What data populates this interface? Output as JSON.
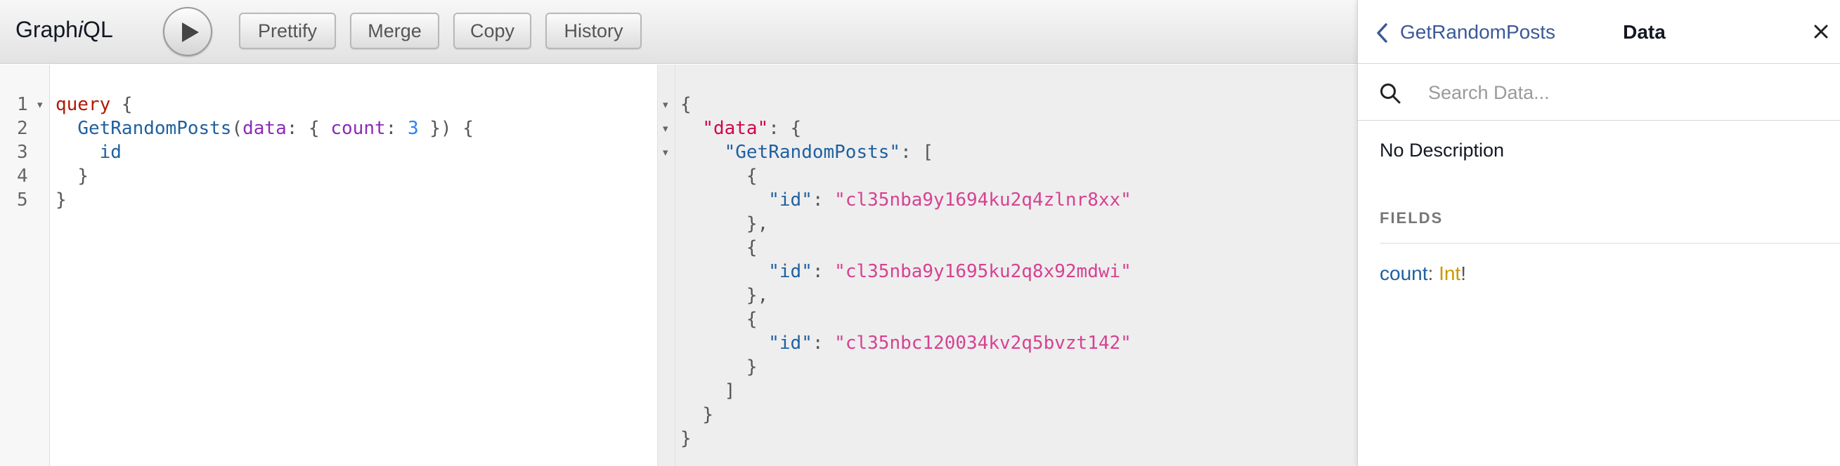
{
  "toolbar": {
    "logo_pre": "Graph",
    "logo_i": "i",
    "logo_post": "QL",
    "run_icon": "play-icon",
    "buttons": {
      "prettify": "Prettify",
      "merge": "Merge",
      "copy": "Copy",
      "history": "History"
    }
  },
  "query_editor": {
    "line_numbers": [
      "1",
      "2",
      "3",
      "4",
      "5"
    ],
    "fold_markers": [
      "▾"
    ],
    "tokens": {
      "l1_kw": "query",
      "l1_brace": " {",
      "l2_field": "GetRandomPosts",
      "l2_open": "(",
      "l2_arg": "data",
      "l2_colon": ": { ",
      "l2_count": "count",
      "l2_colon2": ": ",
      "l2_num": "3",
      "l2_close": " }) {",
      "l3_field": "id",
      "l4": "}",
      "l5": "}"
    }
  },
  "result_viewer": {
    "fold_markers": [
      "▾",
      "▾",
      "▾"
    ],
    "lines": {
      "r1": "{",
      "r2_key": "\"data\"",
      "r2_rest": ": {",
      "r3_key": "\"GetRandomPosts\"",
      "r3_rest": ": [",
      "r4": "{",
      "id_key": "\"id\"",
      "id_sep": ": ",
      "r5_val": "\"cl35nba9y1694ku2q4zlnr8xx\"",
      "r6": "},",
      "r7": "{",
      "r8_val": "\"cl35nba9y1695ku2q8x92mdwi\"",
      "r9": "},",
      "r10": "{",
      "r11_val": "\"cl35nbc120034kv2q5bvzt142\"",
      "r12": "}",
      "r13": "]",
      "r14": "}",
      "r15": "}"
    }
  },
  "docs": {
    "back_label": "GetRandomPosts",
    "title": "Data",
    "back_icon": "chevron-left-icon",
    "close_icon": "close-icon",
    "search_icon": "search-icon",
    "search_placeholder": "Search Data...",
    "search_value": "",
    "description": "No Description",
    "fields_header": "FIELDS",
    "fields": [
      {
        "name": "count",
        "colon": ": ",
        "type": "Int",
        "suffix": "!"
      }
    ]
  },
  "colors": {
    "keyword": "#b11a04",
    "field": "#1f61a0",
    "argument": "#8b2bb9",
    "number": "#2882f9",
    "string": "#d64292",
    "json_key_data": "#d2054e",
    "type": "#ca9800",
    "link": "#3b5998"
  }
}
